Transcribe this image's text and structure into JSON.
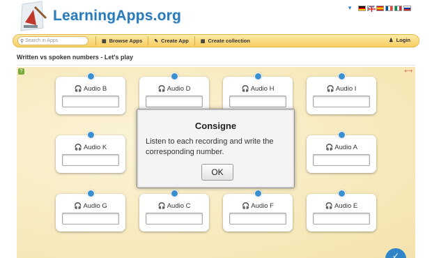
{
  "header": {
    "logo_text": "LearningApps.org",
    "colors": {
      "logo_blue": "#2b7bb9",
      "nav_gold": "#f6cf64"
    },
    "languages": [
      "de",
      "en",
      "es",
      "fr",
      "it",
      "ru"
    ]
  },
  "navbar": {
    "search_placeholder": "Search in Apps",
    "items": [
      {
        "label": "Browse Apps",
        "icon": "grid-icon"
      },
      {
        "label": "Create App",
        "icon": "pencil-icon"
      },
      {
        "label": "Create collection",
        "icon": "collection-icon"
      }
    ],
    "login_label": "Login"
  },
  "page": {
    "title": "Written vs spoken numbers - Let's play"
  },
  "cards": [
    {
      "label": "Audio B",
      "value": ""
    },
    {
      "label": "Audio D",
      "value": ""
    },
    {
      "label": "Audio H",
      "value": ""
    },
    {
      "label": "Audio I",
      "value": ""
    },
    {
      "label": "Audio K",
      "value": ""
    },
    {
      "label": "Audio A",
      "value": ""
    },
    {
      "label": "Audio G",
      "value": ""
    },
    {
      "label": "Audio C",
      "value": ""
    },
    {
      "label": "Audio F",
      "value": ""
    },
    {
      "label": "Audio E",
      "value": ""
    }
  ],
  "modal": {
    "title": "Consigne",
    "text": "Listen to each recording and write the corresponding number.",
    "ok_label": "OK"
  }
}
